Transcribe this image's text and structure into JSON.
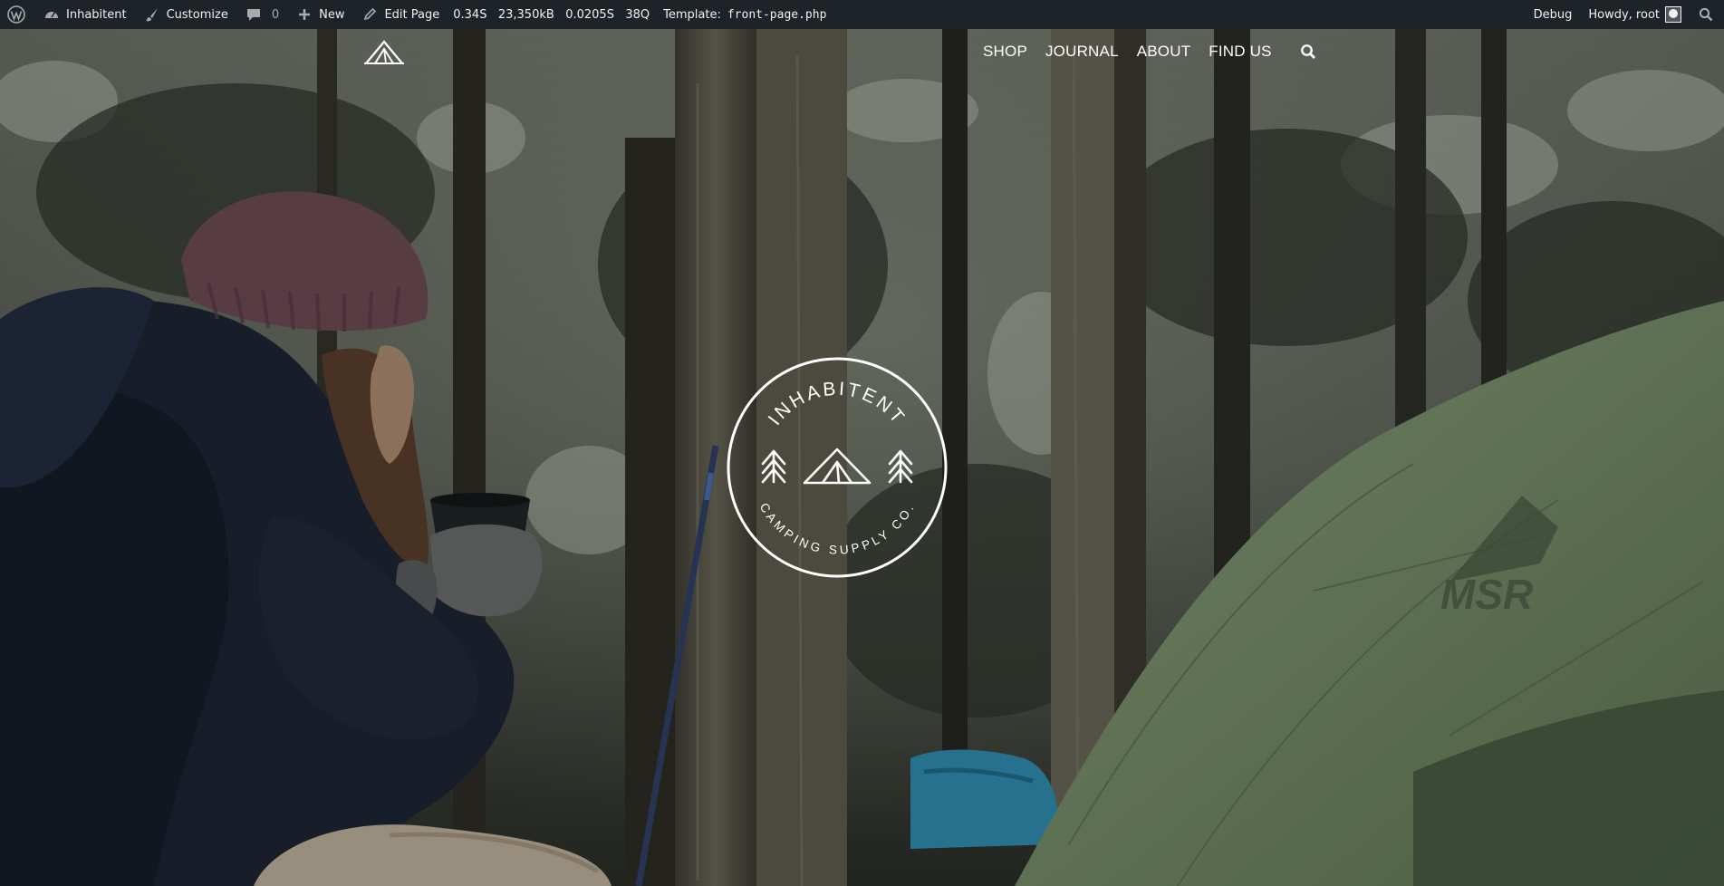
{
  "adminbar": {
    "site_name": "Inhabitent",
    "customize": "Customize",
    "comments_count": "0",
    "new_label": "New",
    "edit_page": "Edit Page",
    "perf_time": "0.34S",
    "perf_memory": "23,350kB",
    "perf_query_time": "0.0205S",
    "perf_queries": "38Q",
    "template_label": "Template:",
    "template_file": "front-page.php",
    "debug": "Debug",
    "howdy": "Howdy, root"
  },
  "nav": {
    "items": [
      "SHOP",
      "JOURNAL",
      "ABOUT",
      "FIND US"
    ]
  },
  "badge": {
    "top_text": "INHABITENT",
    "bottom_text": "CAMPING SUPPLY CO."
  },
  "icons": {
    "wp_logo": "wordpress-icon",
    "site": "dashboard-icon",
    "customize": "paintbrush-icon",
    "comments": "comment-icon",
    "new": "plus-icon",
    "edit": "pencil-icon",
    "search": "search-icon"
  },
  "colors": {
    "adminbar_bg": "#1d2327",
    "tent": "#7f9670",
    "jacket": "#1b2233",
    "beanie": "#6f4a55"
  }
}
